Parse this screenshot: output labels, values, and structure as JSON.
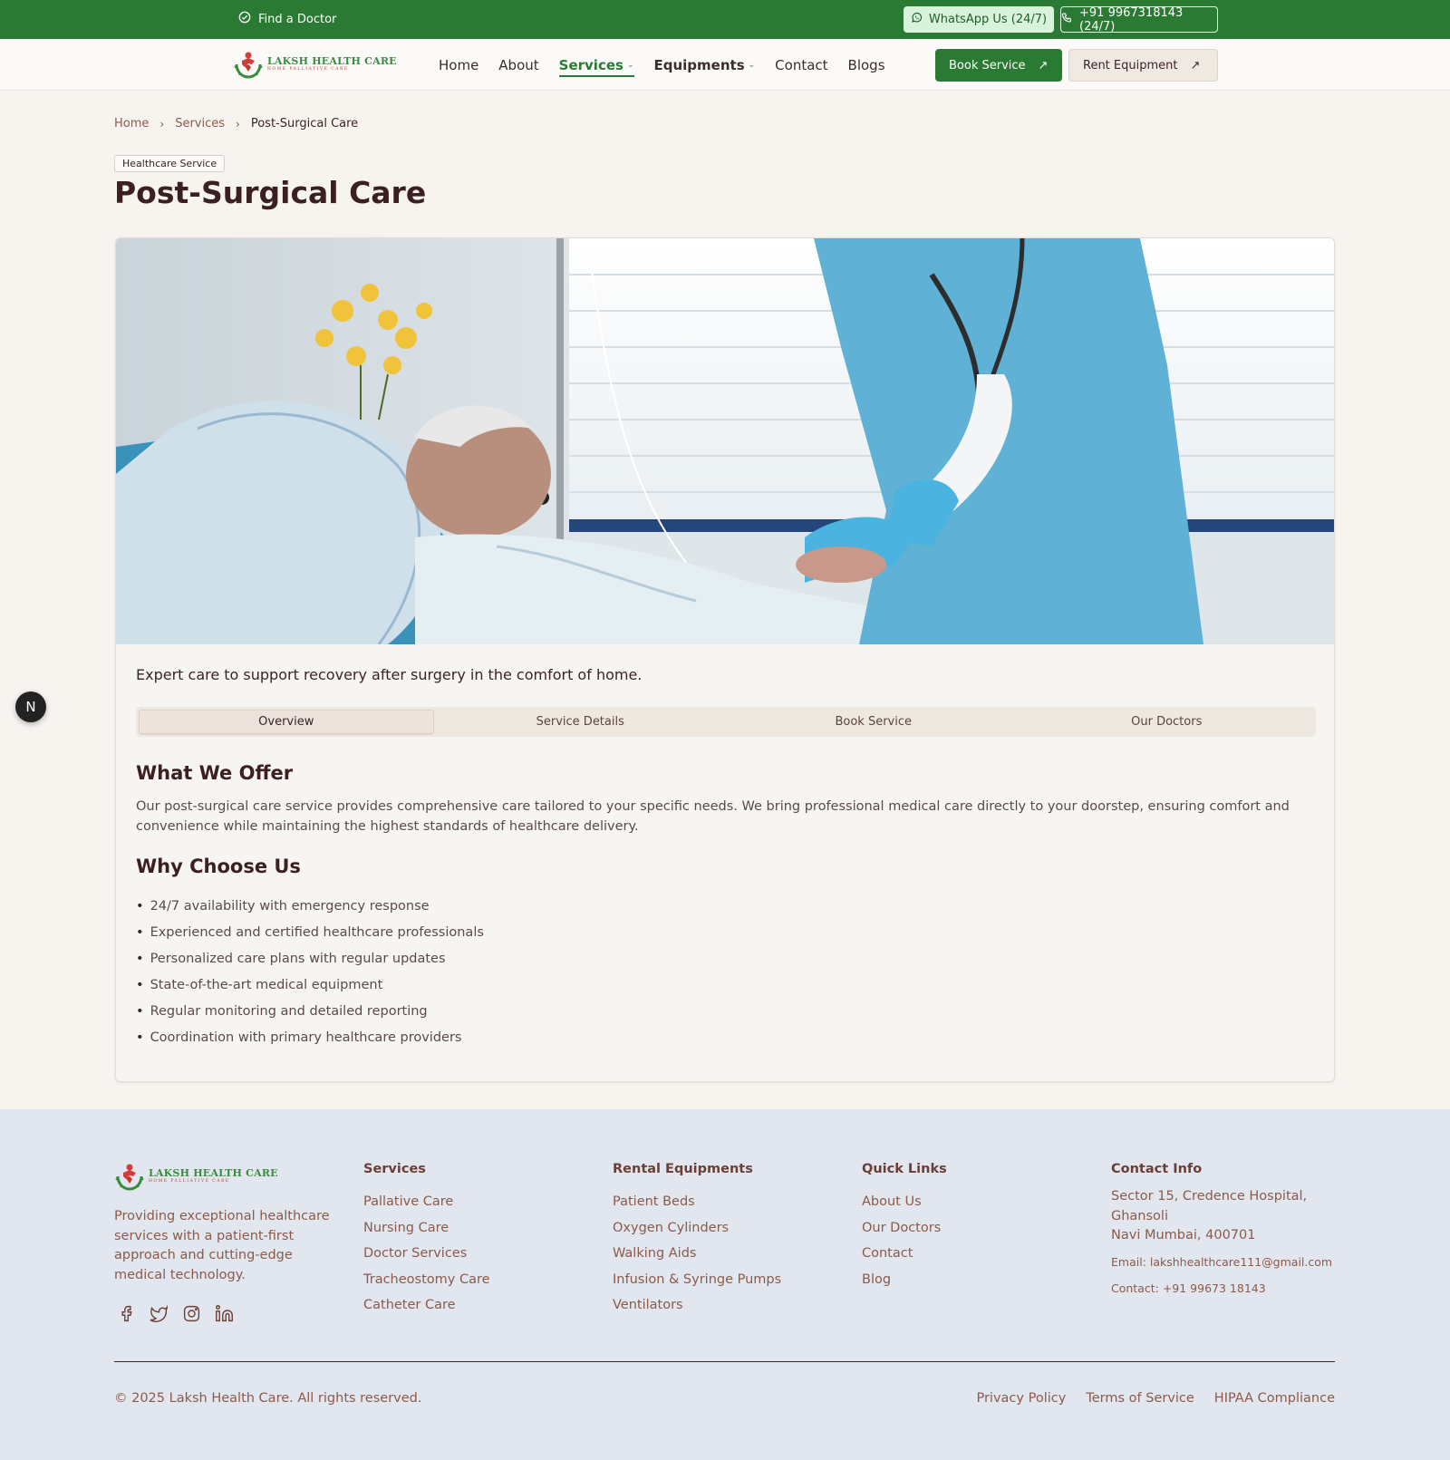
{
  "topbar": {
    "find_doctor": "Find a Doctor",
    "whatsapp": "WhatsApp Us (24/7)",
    "phone": "+91 9967318143 (24/7)"
  },
  "brand": {
    "name": "LAKSH HEALTH CARE",
    "tagline": "HOME PALLIATIVE CARE"
  },
  "nav": {
    "items": [
      {
        "label": "Home"
      },
      {
        "label": "About"
      },
      {
        "label": "Services"
      },
      {
        "label": "Equipments"
      },
      {
        "label": "Contact"
      },
      {
        "label": "Blogs"
      }
    ],
    "active": "Services",
    "book_service": "Book Service",
    "rent_equipment": "Rent Equipment"
  },
  "breadcrumb": [
    "Home",
    "Services",
    "Post-Surgical Care"
  ],
  "page": {
    "badge": "Healthcare Service",
    "title": "Post-Surgical Care",
    "tagline": "Expert care to support recovery after surgery in the comfort of home."
  },
  "tabs": [
    "Overview",
    "Service Details",
    "Book Service",
    "Our Doctors"
  ],
  "active_tab": "Overview",
  "offer": {
    "heading": "What We Offer",
    "text": "Our post-surgical care service provides comprehensive care tailored to your specific needs. We bring professional medical care directly to your doorstep, ensuring comfort and convenience while maintaining the highest standards of healthcare delivery."
  },
  "why": {
    "heading": "Why Choose Us",
    "items": [
      "24/7 availability with emergency response",
      "Experienced and certified healthcare professionals",
      "Personalized care plans with regular updates",
      "State-of-the-art medical equipment",
      "Regular monitoring and detailed reporting",
      "Coordination with primary healthcare providers"
    ]
  },
  "floating_button": "N",
  "footer": {
    "description": "Providing exceptional healthcare services with a patient-first approach and cutting-edge medical technology.",
    "services": {
      "heading": "Services",
      "items": [
        "Pallative Care",
        "Nursing Care",
        "Doctor Services",
        "Tracheostomy Care",
        "Catheter Care"
      ]
    },
    "rental": {
      "heading": "Rental Equipments",
      "items": [
        "Patient Beds",
        "Oxygen Cylinders",
        "Walking Aids",
        "Infusion & Syringe Pumps",
        "Ventilators"
      ]
    },
    "quick_links": {
      "heading": "Quick Links",
      "items": [
        "About Us",
        "Our Doctors",
        "Contact",
        "Blog"
      ]
    },
    "contact": {
      "heading": "Contact Info",
      "address_1": "Sector 15, Credence Hospital, Ghansoli",
      "address_2": "Navi Mumbai, 400701",
      "email": "Email: lakshhealthcare111@gmail.com",
      "phone": "Contact: +91 99673 18143"
    },
    "copyright": "© 2025 Laksh Health Care. All rights reserved.",
    "legal": [
      "Privacy Policy",
      "Terms of Service",
      "HIPAA Compliance"
    ]
  },
  "colors": {
    "brand_green": "#2a7a33",
    "title_brown": "#3b2020",
    "footer_bg": "#e2e7ef"
  }
}
